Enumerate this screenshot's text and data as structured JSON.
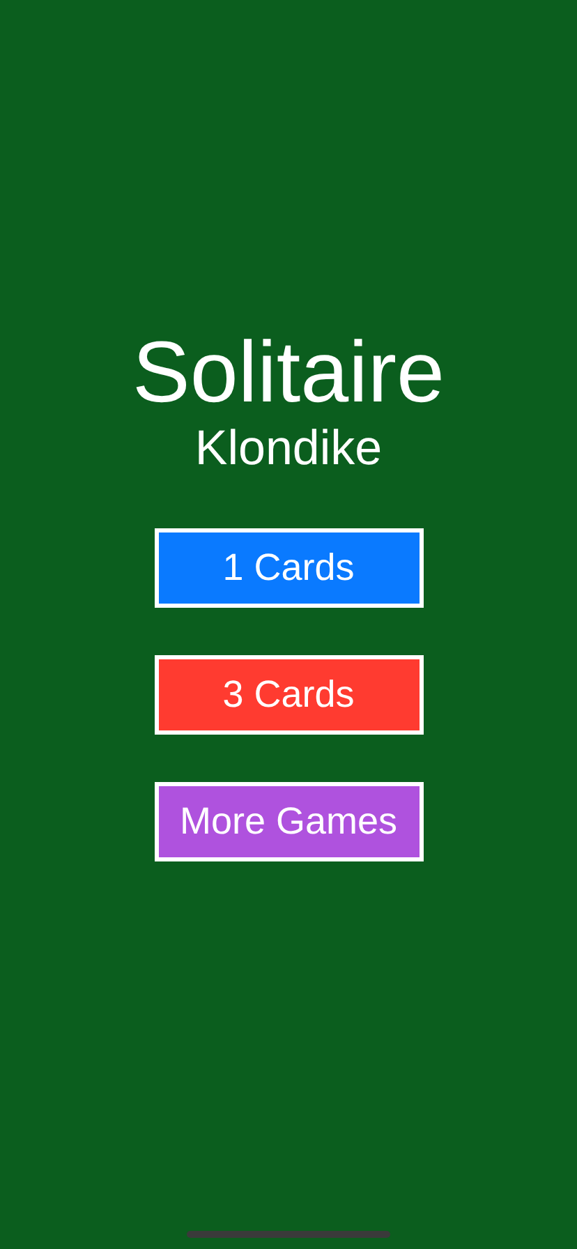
{
  "title": "Solitaire",
  "subtitle": "Klondike",
  "buttons": [
    {
      "label": "1 Cards",
      "color": "#0a7aff"
    },
    {
      "label": "3 Cards",
      "color": "#ff3b30"
    },
    {
      "label": "More Games",
      "color": "#af52de"
    }
  ]
}
